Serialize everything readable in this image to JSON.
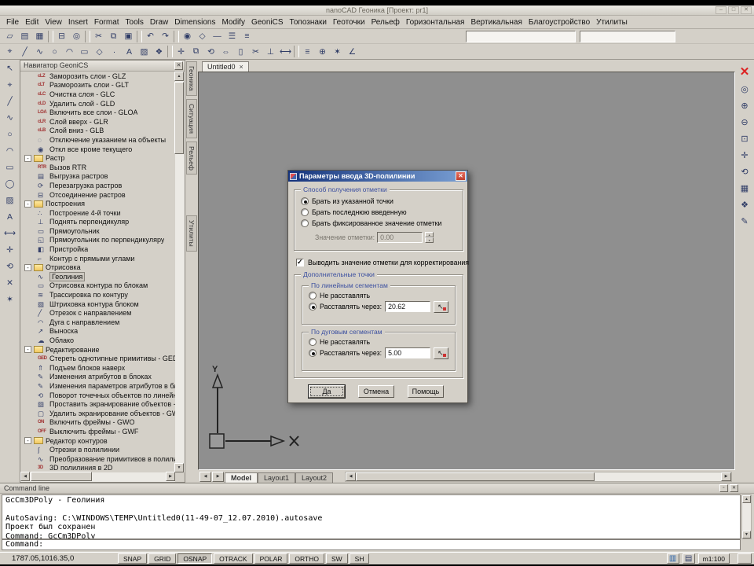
{
  "window": {
    "title": "nanoCAD Геоника [Проект: pr1]",
    "min": "–",
    "max": "□",
    "close": "✕"
  },
  "menu": [
    "File",
    "Edit",
    "View",
    "Insert",
    "Format",
    "Tools",
    "Draw",
    "Dimensions",
    "Modify",
    "GeoniCS",
    "Топознаки",
    "Геоточки",
    "Рельеф",
    "Горизонтальная",
    "Вертикальная",
    "Благоустройство",
    "Утилиты"
  ],
  "toolbar1": [
    {
      "g": "▱",
      "n": "new-icon"
    },
    {
      "g": "▤",
      "n": "open-icon"
    },
    {
      "g": "▦",
      "n": "save-icon"
    },
    {
      "n": "separator",
      "cls": "sep"
    },
    {
      "g": "⊟",
      "n": "print-icon"
    },
    {
      "g": "◎",
      "n": "print-preview-icon"
    },
    {
      "n": "separator",
      "cls": "sep"
    },
    {
      "g": "✂",
      "n": "cut-icon"
    },
    {
      "g": "⧉",
      "n": "copy-icon"
    },
    {
      "g": "▣",
      "n": "paste-icon"
    },
    {
      "n": "separator",
      "cls": "sep"
    },
    {
      "g": "↶",
      "n": "undo-icon"
    },
    {
      "g": "↷",
      "n": "redo-icon"
    },
    {
      "n": "separator",
      "cls": "sep"
    },
    {
      "g": "◉",
      "n": "layers-icon"
    },
    {
      "g": "◇",
      "n": "color-icon"
    },
    {
      "g": "—",
      "n": "linetype-icon"
    },
    {
      "g": "☰",
      "n": "lineweight-icon"
    },
    {
      "g": "≡",
      "n": "properties-icon"
    }
  ],
  "toolbar1_fields": {
    "field1": "",
    "field2": ""
  },
  "toolbar2": [
    {
      "g": "⌖",
      "n": "snap-icon"
    },
    {
      "g": "╱",
      "n": "line-icon"
    },
    {
      "g": "∿",
      "n": "polyline-icon"
    },
    {
      "g": "○",
      "n": "circle-icon"
    },
    {
      "g": "◠",
      "n": "arc-icon"
    },
    {
      "g": "▭",
      "n": "rectangle-icon"
    },
    {
      "g": "◇",
      "n": "polygon-icon"
    },
    {
      "g": "·",
      "n": "point-icon"
    },
    {
      "g": "A",
      "n": "text-icon"
    },
    {
      "g": "▨",
      "n": "hatch-icon"
    },
    {
      "g": "❖",
      "n": "block-icon"
    },
    {
      "n": "separator",
      "cls": "sep"
    },
    {
      "g": "✛",
      "n": "move-icon"
    },
    {
      "g": "⧉",
      "n": "copy-object-icon"
    },
    {
      "g": "⟲",
      "n": "rotate-icon"
    },
    {
      "g": "⇔",
      "n": "stretch-icon"
    },
    {
      "g": "▯",
      "n": "scale-icon"
    },
    {
      "g": "✂",
      "n": "trim-icon"
    },
    {
      "g": "⊥",
      "n": "perpendicular-icon"
    },
    {
      "g": "⟷",
      "n": "dimension-icon"
    },
    {
      "n": "separator",
      "cls": "sep"
    },
    {
      "g": "≡",
      "n": "list-icon"
    },
    {
      "g": "⊕",
      "n": "insert-block-icon"
    },
    {
      "g": "✶",
      "n": "explode-icon"
    },
    {
      "g": "∠",
      "n": "angle-icon"
    }
  ],
  "left_toolbar": [
    {
      "g": "↖",
      "n": "select-icon"
    },
    {
      "g": "⌖",
      "n": "pick-icon"
    },
    {
      "g": "╱",
      "n": "line-icon"
    },
    {
      "g": "∿",
      "n": "polyline-icon"
    },
    {
      "g": "○",
      "n": "circle-icon"
    },
    {
      "g": "◠",
      "n": "arc-icon"
    },
    {
      "g": "▭",
      "n": "rectangle-icon"
    },
    {
      "g": "◯",
      "n": "ellipse-icon"
    },
    {
      "g": "▨",
      "n": "hatch-icon"
    },
    {
      "g": "A",
      "n": "text-icon"
    },
    {
      "g": "⟷",
      "n": "dimension-icon"
    },
    {
      "g": "✛",
      "n": "move-icon"
    },
    {
      "g": "⟲",
      "n": "rotate-icon"
    },
    {
      "g": "✕",
      "n": "erase-icon"
    },
    {
      "g": "✶",
      "n": "explode-icon"
    }
  ],
  "right_toolbar": [
    {
      "g": "✕",
      "n": "close-drawing-icon",
      "cls": "red"
    },
    {
      "g": "◎",
      "n": "zoom-window-icon"
    },
    {
      "g": "⊕",
      "n": "zoom-in-icon"
    },
    {
      "g": "⊖",
      "n": "zoom-out-icon"
    },
    {
      "g": "⊡",
      "n": "zoom-extents-icon"
    },
    {
      "g": "✛",
      "n": "pan-icon"
    },
    {
      "g": "⟲",
      "n": "regen-icon"
    },
    {
      "g": "▦",
      "n": "grid-icon"
    },
    {
      "g": "❖",
      "n": "views-icon"
    },
    {
      "g": "✎",
      "n": "sketch-icon"
    }
  ],
  "navigator": {
    "title": "Навигатор GeoniCS",
    "close": "✕",
    "tree": [
      {
        "g": "cLZ",
        "label": "Заморозить слои - GLZ",
        "cls": "txt"
      },
      {
        "g": "cLT",
        "label": "Разморозить слои - GLT",
        "cls": "txt"
      },
      {
        "g": "cLC",
        "label": "Очистка слоя - GLC",
        "cls": "txt"
      },
      {
        "g": "cLD",
        "label": "Удалить слой - GLD",
        "cls": "txt"
      },
      {
        "g": "LOA",
        "label": "Включить все слои - GLOA",
        "cls": "txt"
      },
      {
        "g": "cLR",
        "label": "Слой вверх - GLR",
        "cls": "txt"
      },
      {
        "g": "cLB",
        "label": "Слой вниз - GLB",
        "cls": "txt"
      },
      {
        "g": "◌",
        "label": "Отключение указанием на объекты"
      },
      {
        "g": "◉",
        "label": "Откл все кроме текущего"
      },
      {
        "exp": "-",
        "label": "Растр",
        "cls": "folder"
      },
      {
        "g": "RTR",
        "label": "Вызов RTR",
        "cls": "txt"
      },
      {
        "g": "▤",
        "label": "Выгрузка растров"
      },
      {
        "g": "⟳",
        "label": "Перезагрузка растров"
      },
      {
        "g": "⊟",
        "label": "Отсоединение растров"
      },
      {
        "exp": "-",
        "label": "Построения",
        "cls": "folder"
      },
      {
        "g": "∴",
        "label": "Построение 4-й точки"
      },
      {
        "g": "⊥",
        "label": "Поднять перпендикуляр"
      },
      {
        "g": "▭",
        "label": "Прямоугольник"
      },
      {
        "g": "◱",
        "label": "Прямоугольник по перпендикуляру"
      },
      {
        "g": "◧",
        "label": "Пристройка"
      },
      {
        "g": "⌐",
        "label": "Контур с прямыми углами"
      },
      {
        "exp": "-",
        "label": "Отрисовка",
        "cls": "folder"
      },
      {
        "g": "∿",
        "label": "Геолиния",
        "cls": "sel"
      },
      {
        "g": "▭",
        "label": "Отрисовка контура по блокам"
      },
      {
        "g": "≋",
        "label": "Трассировка по контуру"
      },
      {
        "g": "▨",
        "label": "Штриховка контура блоком"
      },
      {
        "g": "╱",
        "label": "Отрезок с направлением"
      },
      {
        "g": "◠",
        "label": "Дуга с направлением"
      },
      {
        "g": "↗",
        "label": "Выноска"
      },
      {
        "g": "☁",
        "label": "Облако"
      },
      {
        "exp": "-",
        "label": "Редактирование",
        "cls": "folder"
      },
      {
        "g": "GED",
        "label": "Стереть однотипные примитивы - GED",
        "cls": "txt"
      },
      {
        "g": "⇑",
        "label": "Подъем блоков наверх"
      },
      {
        "g": "✎",
        "label": "Изменения атрибутов в блоках"
      },
      {
        "g": "✎",
        "label": "Изменения параметров атрибутов в блоках"
      },
      {
        "g": "⟲",
        "label": "Поворот точечных объектов по линейным"
      },
      {
        "g": "▧",
        "label": "Проставить экранирование объектов - GWP"
      },
      {
        "g": "▢",
        "label": "Удалить экранирование объектов - GWT"
      },
      {
        "g": "ON",
        "label": "Включить фреймы - GWO",
        "cls": "txt"
      },
      {
        "g": "OFF",
        "label": "Выключить фреймы - GWF",
        "cls": "txt"
      },
      {
        "exp": "-",
        "label": "Редактор контуров",
        "cls": "folder"
      },
      {
        "g": "∫",
        "label": "Отрезки в полилинии"
      },
      {
        "g": "∿",
        "label": "Преобразование примитивов в полилинии"
      },
      {
        "g": "3D",
        "label": "3D полилиния в 2D",
        "cls": "txt"
      }
    ]
  },
  "side_tabs": [
    {
      "label": "Геоника"
    },
    {
      "label": "Ситуация"
    },
    {
      "label": "Рельеф"
    },
    {
      "label": "Утилиты",
      "cls": "gap"
    }
  ],
  "document": {
    "tab": "Untitled0",
    "ucs": {
      "y_label": "Y"
    }
  },
  "layout_tabs": [
    {
      "label": "Model",
      "cls": "active"
    },
    {
      "label": "Layout1"
    },
    {
      "label": "Layout2"
    }
  ],
  "dialog": {
    "title": "Параметры ввода 3D-полилинии",
    "close": "✕",
    "group_method": {
      "label": "Способ получения отметки",
      "options": [
        {
          "label": "Брать из указанной точки",
          "cls": "on",
          "n": "radio-take-from-point"
        },
        {
          "label": "Брать последнюю введенную",
          "n": "radio-take-last-entered"
        },
        {
          "label": "Брать фиксированное значение отметки",
          "n": "radio-take-fixed-value"
        }
      ],
      "value_label": "Значение отметки:",
      "value": "0.00"
    },
    "checkbox": {
      "label": "Выводить значение отметки для корректирования"
    },
    "group_extra": {
      "label": "Дополнительные точки",
      "linear": {
        "label": "По линейным сегментам",
        "opt1": "Не расставлять",
        "opt2": "Расставлять через:",
        "value": "20.62"
      },
      "arc": {
        "label": "По дуговым сегментам",
        "opt1": "Не расставлять",
        "opt2": "Расставлять через:",
        "value": "5.00"
      }
    },
    "buttons": {
      "ok": "Да",
      "cancel": "Отмена",
      "help": "Помощь"
    }
  },
  "command_panel": {
    "title": "Command line",
    "lines": [
      "GcCm3DPoly - Геолиния",
      "",
      "AutoSaving: C:\\WINDOWS\\TEMP\\Untitled0(11-49-07_12.07.2010).autosave",
      "Проект был сохранен",
      "Command: GcCm3DPoly"
    ],
    "prompt": "Command:"
  },
  "status_bar": {
    "coords": "1787.05,1016.35,0",
    "toggles": [
      {
        "label": "SNAP"
      },
      {
        "label": "GRID"
      },
      {
        "label": "OSNAP",
        "cls": "pressed"
      },
      {
        "label": "OTRACK"
      },
      {
        "label": "POLAR"
      },
      {
        "label": "ORTHO"
      },
      {
        "label": "SW"
      },
      {
        "label": "SH"
      }
    ],
    "icons": [
      {
        "g": "▥",
        "n": "display-settings-icon",
        "cls": "blue"
      },
      {
        "g": "▤",
        "n": "notes-icon"
      }
    ],
    "scale": "m1:100"
  }
}
